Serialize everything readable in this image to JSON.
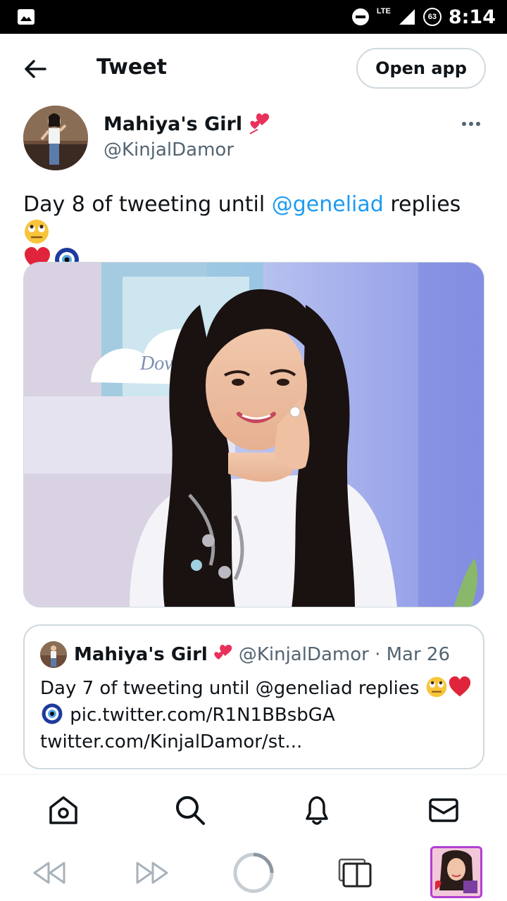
{
  "status_bar": {
    "time": "8:14",
    "network": "LTE",
    "battery": "63"
  },
  "header": {
    "title": "Tweet",
    "open_app_label": "Open app"
  },
  "tweet": {
    "author_name": "Mahiya's Girl",
    "author_handle": "@KinjalDamor",
    "text_before": "Day 8 of tweeting until ",
    "mention": "@geneliad",
    "text_after": " replies ",
    "media_sign_text": "Dove"
  },
  "quote": {
    "author_name": "Mahiya's Girl",
    "handle_date": "@KinjalDamor · Mar 26",
    "text_line1": "Day 7 of tweeting until @geneliad replies ",
    "link_line": "pic.twitter.com/R1N1BBsbGA",
    "url_line": "twitter.com/KinjalDamor/st..."
  },
  "icons": {
    "back": "arrow-left-icon",
    "more": "more-horizontal-icon",
    "home": "home-icon",
    "search": "search-icon",
    "notifications": "bell-icon",
    "messages": "mail-icon",
    "rewind": "rewind-icon",
    "forward": "fast-forward-icon",
    "loading": "loading-ring-icon",
    "tabs": "tabs-icon"
  },
  "colors": {
    "accent": "#1d9bf0",
    "text": "#0f1419",
    "secondary": "#536471",
    "border": "#cfd9de"
  }
}
